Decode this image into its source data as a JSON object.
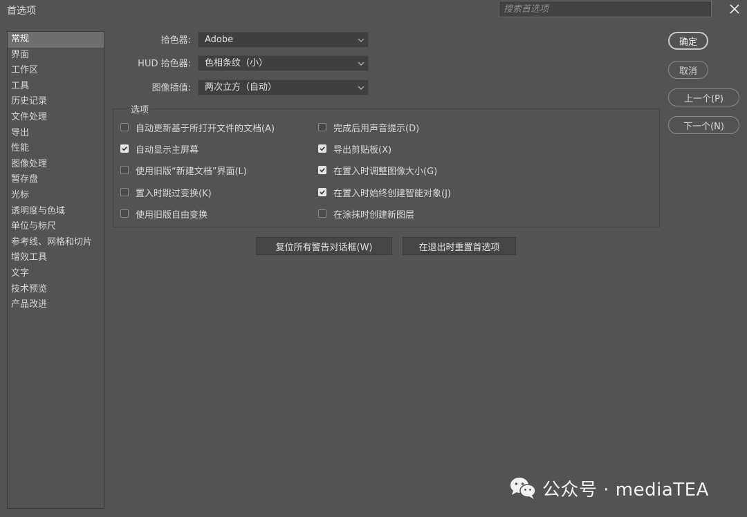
{
  "window": {
    "title": "首选项",
    "search_placeholder": "搜索首选项"
  },
  "sidebar": {
    "items": [
      {
        "label": "常规",
        "active": true
      },
      {
        "label": "界面"
      },
      {
        "label": "工作区"
      },
      {
        "label": "工具"
      },
      {
        "label": "历史记录"
      },
      {
        "label": "文件处理"
      },
      {
        "label": "导出"
      },
      {
        "label": "性能"
      },
      {
        "label": "图像处理"
      },
      {
        "label": "暂存盘"
      },
      {
        "label": "光标"
      },
      {
        "label": "透明度与色域"
      },
      {
        "label": "单位与标尺"
      },
      {
        "label": "参考线、网格和切片"
      },
      {
        "label": "增效工具"
      },
      {
        "label": "文字"
      },
      {
        "label": "技术预览"
      },
      {
        "label": "产品改进"
      }
    ]
  },
  "fields": {
    "color_picker": {
      "label": "拾色器:",
      "value": "Adobe"
    },
    "hud_picker": {
      "label": "HUD 拾色器:",
      "value": "色相条纹（小）"
    },
    "interpolation": {
      "label": "图像插值:",
      "value": "两次立方（自动）"
    }
  },
  "options": {
    "title": "选项",
    "left": [
      {
        "label": "自动更新基于所打开文件的文档(A)",
        "checked": false
      },
      {
        "label": "自动显示主屏幕",
        "checked": true
      },
      {
        "label": "使用旧版“新建文档”界面(L)",
        "checked": false
      },
      {
        "label": "置入时跳过变换(K)",
        "checked": false
      },
      {
        "label": "使用旧版自由变换",
        "checked": false
      }
    ],
    "right": [
      {
        "label": "完成后用声音提示(D)",
        "checked": false
      },
      {
        "label": "导出剪贴板(X)",
        "checked": true
      },
      {
        "label": "在置入时调整图像大小(G)",
        "checked": true
      },
      {
        "label": "在置入时始终创建智能对象(J)",
        "checked": true
      },
      {
        "label": "在涂抹时创建新图层",
        "checked": false
      }
    ]
  },
  "buttons": {
    "reset_warnings": "复位所有警告对话框(W)",
    "reset_on_quit": "在退出时重置首选项",
    "ok": "确定",
    "cancel": "取消",
    "prev": "上一个(P)",
    "next": "下一个(N)"
  },
  "watermark": {
    "text": "公众号 · mediaTEA"
  }
}
